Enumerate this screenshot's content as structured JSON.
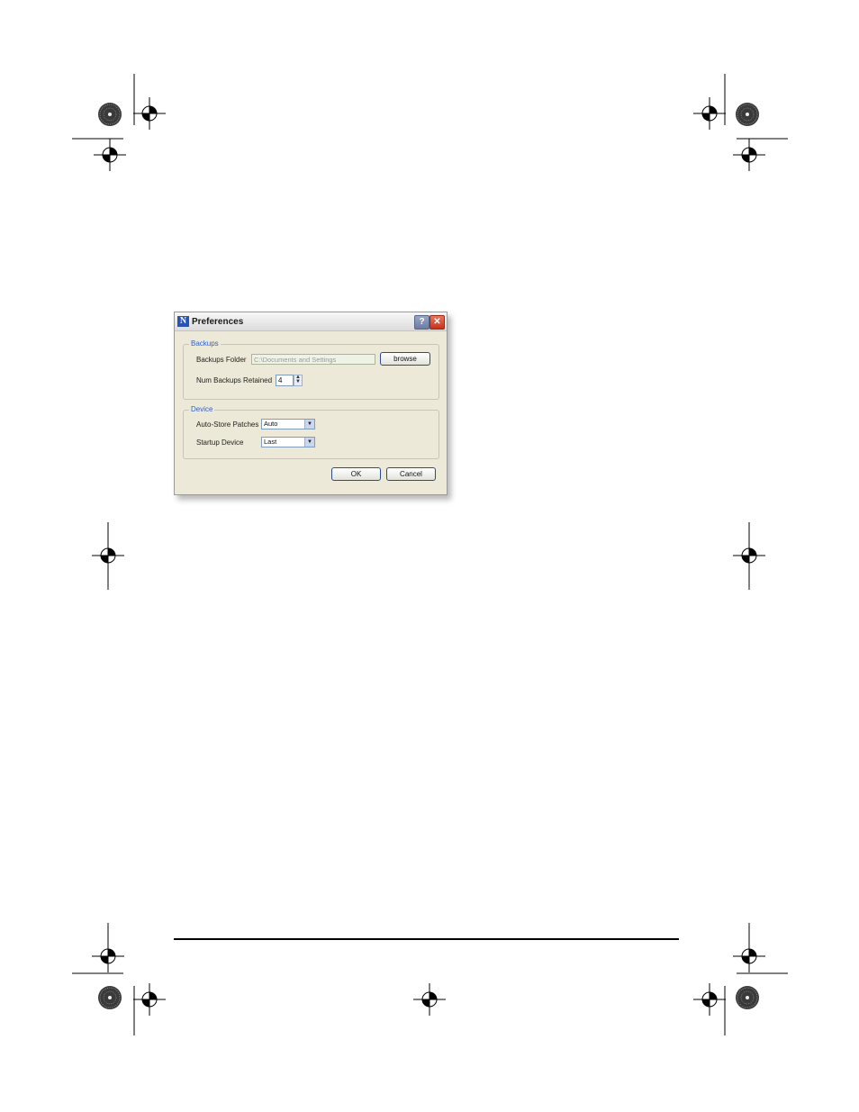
{
  "dialog": {
    "title": "Preferences",
    "help_label": "?",
    "close_label": "✕",
    "app_icon_glyph": "N",
    "backups": {
      "legend": "Backups",
      "folder_label": "Backups Folder",
      "folder_value": "C:\\Documents and Settings",
      "browse_label": "browse",
      "num_label": "Num Backups Retained",
      "num_value": "4"
    },
    "device": {
      "legend": "Device",
      "autostore_label": "Auto-Store Patches",
      "autostore_value": "Auto",
      "startup_label": "Startup Device",
      "startup_value": "Last"
    },
    "ok_label": "OK",
    "cancel_label": "Cancel"
  }
}
